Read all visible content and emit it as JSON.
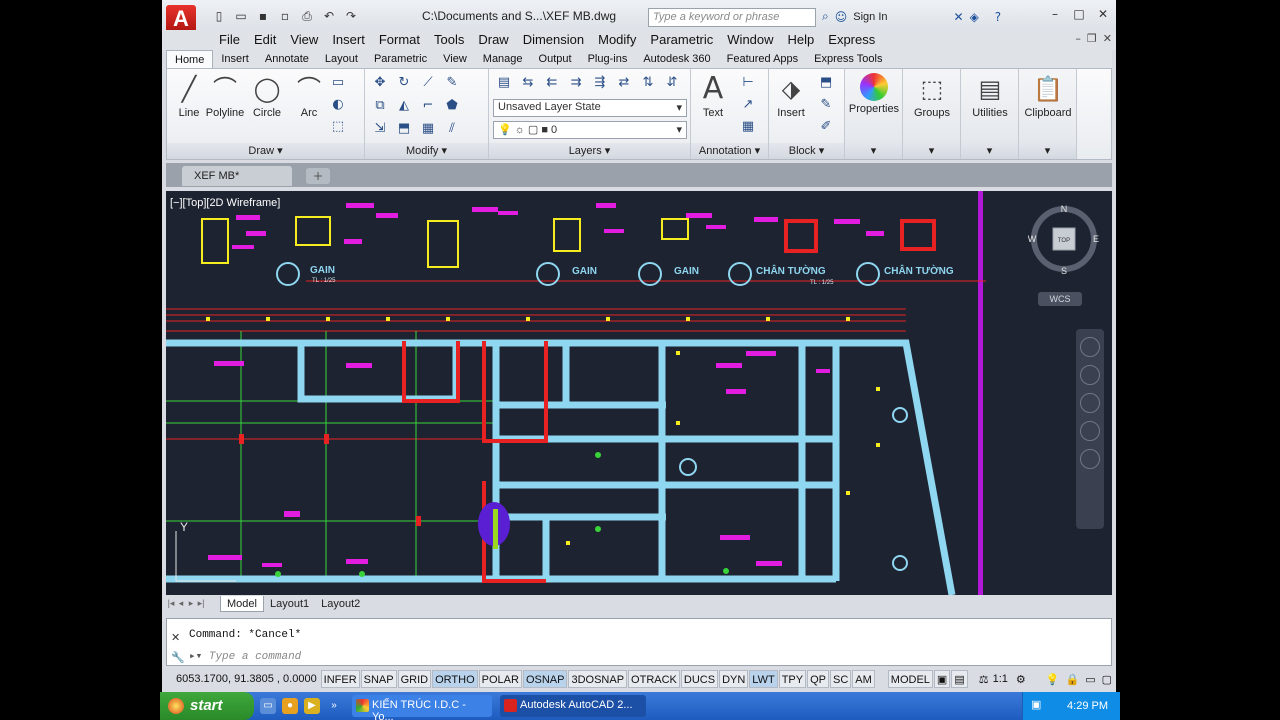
{
  "title": {
    "document": "C:\\Documents and S...\\XEF MB.dwg",
    "logo": "A"
  },
  "search": {
    "placeholder": "Type a keyword or phrase"
  },
  "signin": "Sign In",
  "menus": [
    "File",
    "Edit",
    "View",
    "Insert",
    "Format",
    "Tools",
    "Draw",
    "Dimension",
    "Modify",
    "Parametric",
    "Window",
    "Help",
    "Express"
  ],
  "ribbon_tabs": [
    "Home",
    "Insert",
    "Annotate",
    "Layout",
    "Parametric",
    "View",
    "Manage",
    "Output",
    "Plug-ins",
    "Autodesk 360",
    "Featured Apps",
    "Express Tools"
  ],
  "draw_panel": {
    "title": "Draw",
    "tools": [
      "Line",
      "Polyline",
      "Circle",
      "Arc"
    ]
  },
  "modify_panel": {
    "title": "Modify"
  },
  "layers_panel": {
    "title": "Layers",
    "layer_state": "Unsaved Layer State",
    "current_layer": "0"
  },
  "annotation_panel": {
    "title": "Annotation",
    "text": "Text"
  },
  "block_panel": {
    "title": "Block",
    "insert": "Insert"
  },
  "extra_panels": [
    "Properties",
    "Groups",
    "Utilities",
    "Clipboard"
  ],
  "doc_tab": "XEF MB*",
  "viewport_label": "[−][Top][2D Wireframe]",
  "drawing_labels": {
    "gain1": "GAIN",
    "gain_scale": "TL : 1/25",
    "gain2": "GAIN",
    "gain3": "GAIN",
    "chan1": "CHÂN TƯỜNG",
    "chan2": "CHÂN TƯỜNG",
    "chan_scale": "TL : 1/25"
  },
  "viewcube": {
    "n": "N",
    "s": "S",
    "e": "E",
    "w": "W",
    "face": "TOP",
    "wcs": "WCS"
  },
  "ucs_y": "Y",
  "layout_tabs": [
    "Model",
    "Layout1",
    "Layout2"
  ],
  "command": {
    "history": "Command: *Cancel*",
    "placeholder": "Type a command"
  },
  "status": {
    "coords": "6053.1700, 91.3805 , 0.0000",
    "toggles": [
      "INFER",
      "SNAP",
      "GRID",
      "ORTHO",
      "POLAR",
      "OSNAP",
      "3DOSNAP",
      "OTRACK",
      "DUCS",
      "DYN",
      "LWT",
      "TPY",
      "QP",
      "SC",
      "AM"
    ],
    "model": "MODEL",
    "scale": "1:1"
  },
  "taskbar": {
    "start": "start",
    "tasks": [
      "KIẾN TRÚC I.D.C - Yo...",
      "Autodesk AutoCAD 2..."
    ],
    "clock": "4:29 PM"
  },
  "colors": {
    "cyan": "#8fd6f0",
    "magenta": "#e21ce0",
    "red": "#e82222",
    "yellow": "#f6ec1e",
    "green": "#39d439",
    "background": "#1d2330"
  }
}
